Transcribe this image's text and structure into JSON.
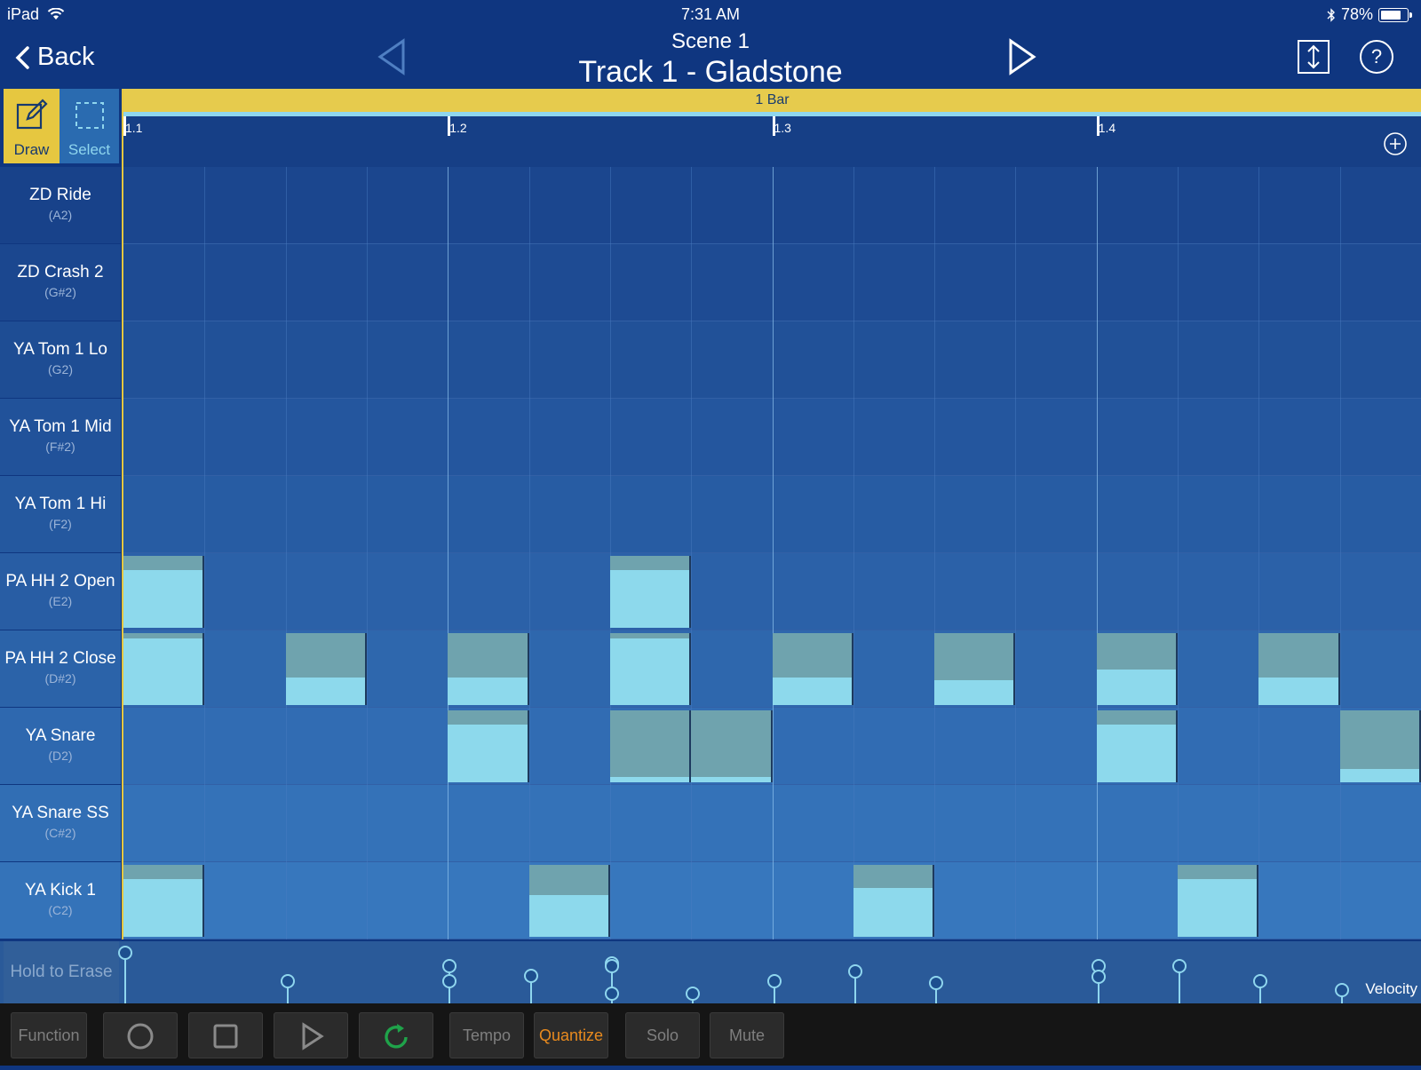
{
  "status": {
    "device": "iPad",
    "time": "7:31 AM",
    "battery": "78%",
    "battery_level": 0.78
  },
  "nav": {
    "back_label": "Back",
    "scene_title": "Scene  1",
    "track_title": "Track 1 - Gladstone"
  },
  "tools": {
    "draw_label": "Draw",
    "select_label": "Select"
  },
  "timeline": {
    "bar_label": "1 Bar",
    "beats": [
      "1.1",
      "1.2",
      "1.3",
      "1.4"
    ]
  },
  "lanes": [
    {
      "name": "ZD Ride",
      "note": "(A2)"
    },
    {
      "name": "ZD Crash 2",
      "note": "(G#2)"
    },
    {
      "name": "YA Tom 1 Lo",
      "note": "(G2)"
    },
    {
      "name": "YA Tom 1 Mid",
      "note": "(F#2)"
    },
    {
      "name": "YA Tom 1 Hi",
      "note": "(F2)"
    },
    {
      "name": "PA HH 2 Open",
      "note": "(E2)"
    },
    {
      "name": "PA HH 2 Close",
      "note": "(D#2)"
    },
    {
      "name": "YA Snare",
      "note": "(D2)"
    },
    {
      "name": "YA Snare SS",
      "note": "(C#2)"
    },
    {
      "name": "YA Kick 1",
      "note": "(C2)"
    }
  ],
  "steps_per_bar": 16,
  "notes": [
    {
      "lane": 5,
      "step": 0,
      "length": 1,
      "velocity": 0.8
    },
    {
      "lane": 5,
      "step": 6,
      "length": 1,
      "velocity": 0.8
    },
    {
      "lane": 6,
      "step": 0,
      "length": 1,
      "velocity": 0.92
    },
    {
      "lane": 6,
      "step": 2,
      "length": 1,
      "velocity": 0.38
    },
    {
      "lane": 6,
      "step": 4,
      "length": 1,
      "velocity": 0.38
    },
    {
      "lane": 6,
      "step": 6,
      "length": 1,
      "velocity": 0.92
    },
    {
      "lane": 6,
      "step": 8,
      "length": 1,
      "velocity": 0.38
    },
    {
      "lane": 6,
      "step": 10,
      "length": 1,
      "velocity": 0.35
    },
    {
      "lane": 6,
      "step": 12,
      "length": 1,
      "velocity": 0.5
    },
    {
      "lane": 6,
      "step": 14,
      "length": 1,
      "velocity": 0.38
    },
    {
      "lane": 7,
      "step": 4,
      "length": 1,
      "velocity": 0.8
    },
    {
      "lane": 7,
      "step": 6,
      "length": 1,
      "velocity": 0.08
    },
    {
      "lane": 7,
      "step": 7,
      "length": 1,
      "velocity": 0.08
    },
    {
      "lane": 7,
      "step": 12,
      "length": 1,
      "velocity": 0.8
    },
    {
      "lane": 7,
      "step": 15,
      "length": 1,
      "velocity": 0.18
    },
    {
      "lane": 9,
      "step": 0,
      "length": 1,
      "velocity": 0.8
    },
    {
      "lane": 9,
      "step": 5,
      "length": 1,
      "velocity": 0.58
    },
    {
      "lane": 9,
      "step": 9,
      "length": 1,
      "velocity": 0.68
    },
    {
      "lane": 9,
      "step": 13,
      "length": 1,
      "velocity": 0.8
    }
  ],
  "velocity_points": [
    {
      "step": 0,
      "velocity": 0.95
    },
    {
      "step": 2,
      "velocity": 0.42
    },
    {
      "step": 4,
      "velocity": 0.7
    },
    {
      "step": 4,
      "velocity": 0.42
    },
    {
      "step": 5,
      "velocity": 0.52
    },
    {
      "step": 6,
      "velocity": 0.75
    },
    {
      "step": 6,
      "velocity": 0.7
    },
    {
      "step": 6,
      "velocity": 0.18
    },
    {
      "step": 7,
      "velocity": 0.18
    },
    {
      "step": 8,
      "velocity": 0.42
    },
    {
      "step": 9,
      "velocity": 0.6
    },
    {
      "step": 10,
      "velocity": 0.38
    },
    {
      "step": 12,
      "velocity": 0.7
    },
    {
      "step": 12,
      "velocity": 0.5
    },
    {
      "step": 13,
      "velocity": 0.7
    },
    {
      "step": 14,
      "velocity": 0.42
    },
    {
      "step": 15,
      "velocity": 0.25
    }
  ],
  "hold_to_erase": "Hold to Erase",
  "velocity_label": "Velocity",
  "transport": {
    "function_label": "Function",
    "tempo_label": "Tempo",
    "quantize_label": "Quantize",
    "solo_label": "Solo",
    "mute_label": "Mute"
  },
  "colors": {
    "accent": "#e6c740",
    "note": "#8dd9ec",
    "note_track": "#6fa3ae",
    "loop_icon": "#1fa34a",
    "quantize": "#e88a1e"
  }
}
